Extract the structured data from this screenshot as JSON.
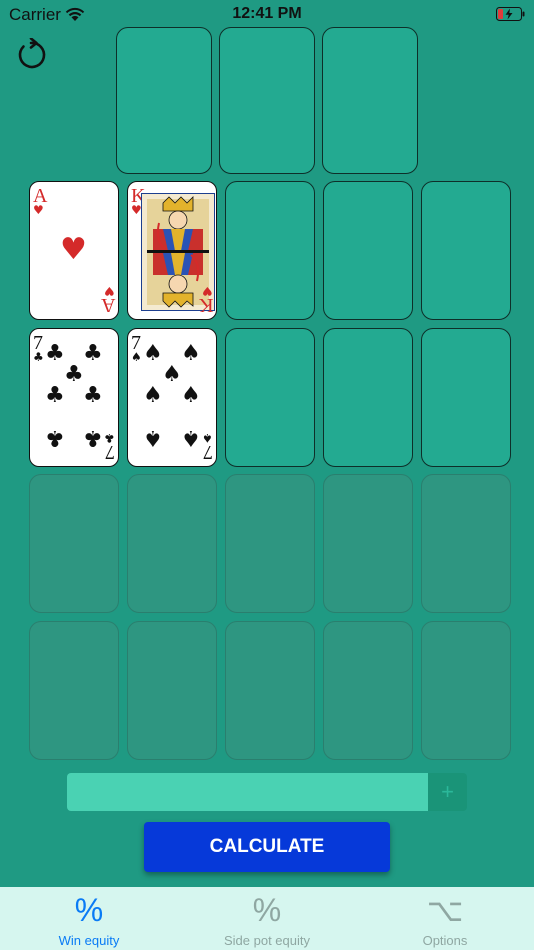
{
  "status_bar": {
    "carrier": "Carrier",
    "time": "12:41 PM"
  },
  "board_slots": [
    {
      "state": "empty"
    },
    {
      "state": "empty"
    },
    {
      "state": "empty"
    }
  ],
  "players": [
    {
      "cards": [
        {
          "rank": "A",
          "suit": "♥"
        },
        {
          "rank": "K",
          "suit": "♥"
        }
      ]
    },
    {
      "cards": [
        {
          "rank": "7",
          "suit": "♣"
        },
        {
          "rank": "7",
          "suit": "♠"
        }
      ]
    }
  ],
  "range_input": {
    "value": "",
    "add_label": "+"
  },
  "calculate_label": "CALCULATE",
  "tabs": [
    {
      "icon": "%",
      "label": "Win equity",
      "active": true
    },
    {
      "icon": "%",
      "label": "Side pot equity",
      "active": false
    },
    {
      "icon": "⌥",
      "label": "Options",
      "active": false
    }
  ],
  "colors": {
    "felt": "#1f9a83",
    "button": "#0639d9",
    "active_tab": "#0a7bf5"
  }
}
